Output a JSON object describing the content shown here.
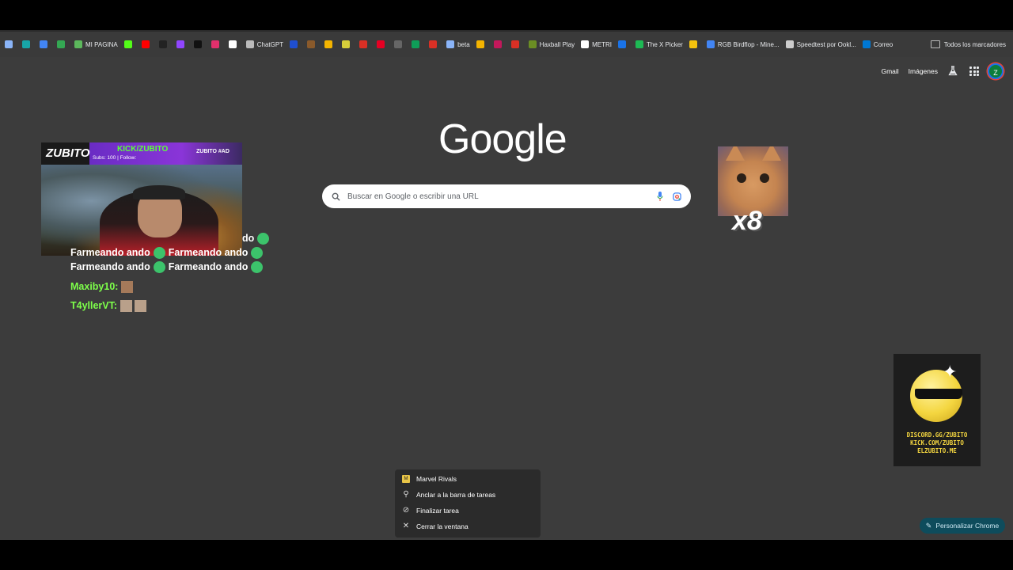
{
  "bookmarks": {
    "items": [
      {
        "label": "",
        "icon": "arrow-icon",
        "color": "#8ab4f8"
      },
      {
        "label": "",
        "icon": "app-icon",
        "color": "#18a5a7"
      },
      {
        "label": "",
        "icon": "download-icon",
        "color": "#4285f4"
      },
      {
        "label": "",
        "icon": "chrome-icon",
        "color": "#34a853"
      },
      {
        "label": "MI PAGINA",
        "icon": "page-icon",
        "color": "#5cb85c"
      },
      {
        "label": "",
        "icon": "kick-icon",
        "color": "#53fc18"
      },
      {
        "label": "",
        "icon": "youtube-icon",
        "color": "#ff0000"
      },
      {
        "label": "",
        "icon": "x-icon",
        "color": "#222222"
      },
      {
        "label": "",
        "icon": "twitch-icon",
        "color": "#9146ff"
      },
      {
        "label": "",
        "icon": "tiktok-icon",
        "color": "#111111"
      },
      {
        "label": "",
        "icon": "instagram-icon",
        "color": "#e1306c"
      },
      {
        "label": "",
        "icon": "diamond-icon",
        "color": "#ffffff"
      },
      {
        "label": "ChatGPT",
        "icon": "chatgpt-icon",
        "color": "#bbbbbb"
      },
      {
        "label": "",
        "icon": "blue-square-icon",
        "color": "#1f4fd1"
      },
      {
        "label": "",
        "icon": "minecraft-icon",
        "color": "#8a5a2b"
      },
      {
        "label": "",
        "icon": "grid-colored-icon",
        "color": "#f4b400"
      },
      {
        "label": "",
        "icon": "pokeball-icon",
        "color": "#d6ce3a"
      },
      {
        "label": "",
        "icon": "shield-icon",
        "color": "#d93025"
      },
      {
        "label": "",
        "icon": "pinterest-icon",
        "color": "#e60023"
      },
      {
        "label": "",
        "icon": "box-icon",
        "color": "#666666"
      },
      {
        "label": "",
        "icon": "dot-icon",
        "color": "#0f9d58"
      },
      {
        "label": "",
        "icon": "cross-icon",
        "color": "#d93025"
      },
      {
        "label": "beta",
        "icon": "grid-icon",
        "color": "#8ab4f8"
      },
      {
        "label": "",
        "icon": "coin-icon",
        "color": "#f4b400"
      },
      {
        "label": "",
        "icon": "circle-icon",
        "color": "#c2185b"
      },
      {
        "label": "",
        "icon": "chart-icon",
        "color": "#d93025"
      },
      {
        "label": "Haxball Play",
        "icon": "haxball-icon",
        "color": "#6b8e23"
      },
      {
        "label": "METRI",
        "icon": "infinity-icon",
        "color": "#ffffff"
      },
      {
        "label": "",
        "icon": "map-icon",
        "color": "#1a73e8"
      },
      {
        "label": "The X Picker",
        "icon": "xpicker-icon",
        "color": "#1db954"
      },
      {
        "label": "",
        "icon": "folder-icon",
        "color": "#f4c20d"
      },
      {
        "label": "RGB Birdflop - Mine...",
        "icon": "birdflop-icon",
        "color": "#4285f4"
      },
      {
        "label": "Speedtest por Ookl...",
        "icon": "speedtest-icon",
        "color": "#cccccc"
      },
      {
        "label": "Correo",
        "icon": "mail-icon",
        "color": "#0078d4"
      }
    ],
    "all_bookmarks": "Todos los marcadores"
  },
  "header": {
    "gmail": "Gmail",
    "images": "Imágenes",
    "avatar_letter": "Z"
  },
  "logo": "Google",
  "search": {
    "placeholder": "Buscar en Google o escribir una URL"
  },
  "stream": {
    "logo": "ZUBITO",
    "kick": "KICK/ZUBITO",
    "subs": "Subs: 100 | Follow:",
    "tag": "ZUBITO #AD"
  },
  "chat": {
    "lines": [
      {
        "text_a": "do",
        "text_b": ""
      },
      {
        "text_a": "Farmeando ando",
        "text_b": "Farmeando ando"
      },
      {
        "text_a": "Farmeando ando",
        "text_b": "Farmeando ando"
      }
    ],
    "users": [
      {
        "name": "Maxiby10:"
      },
      {
        "name": "T4yllerVT:"
      }
    ]
  },
  "cat_overlay": {
    "multiplier": "x8"
  },
  "discord_overlay": {
    "line1": "DISCORD.GG/ZUBITO",
    "line2": "KICK.COM/ZUBITO",
    "line3": "ELZUBITO.ME"
  },
  "context_menu": {
    "items": [
      {
        "label": "Marvel Rivals",
        "icon": "app-icon"
      },
      {
        "label": "Anclar a la barra de tareas",
        "icon": "pin-icon"
      },
      {
        "label": "Finalizar tarea",
        "icon": "block-icon"
      },
      {
        "label": "Cerrar la ventana",
        "icon": "close-icon"
      }
    ]
  },
  "customize_button": "Personalizar Chrome"
}
